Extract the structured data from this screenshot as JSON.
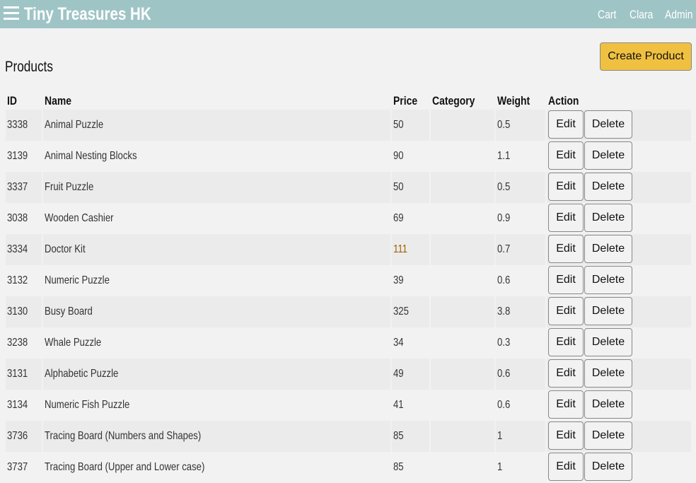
{
  "header": {
    "brand": "Tiny Treasures HK",
    "nav": [
      "Cart",
      "Clara",
      "Admin"
    ]
  },
  "page": {
    "title": "Products",
    "create_label": "Create Product"
  },
  "table": {
    "columns": [
      "ID",
      "Name",
      "Price",
      "Category",
      "Weight",
      "Action"
    ],
    "edit_label": "Edit",
    "delete_label": "Delete",
    "highlight_color": "#a06000",
    "rows": [
      {
        "id": "3338",
        "name": "Animal Puzzle",
        "price": "50",
        "category": "",
        "weight": "0.5"
      },
      {
        "id": "3139",
        "name": "Animal Nesting Blocks",
        "price": "90",
        "category": "",
        "weight": "1.1"
      },
      {
        "id": "3337",
        "name": "Fruit Puzzle",
        "price": "50",
        "category": "",
        "weight": "0.5"
      },
      {
        "id": "3038",
        "name": "Wooden Cashier",
        "price": "69",
        "category": "",
        "weight": "0.9"
      },
      {
        "id": "3334",
        "name": "Doctor Kit",
        "price": "111",
        "category": "",
        "weight": "0.7",
        "highlight": true
      },
      {
        "id": "3132",
        "name": "Numeric Puzzle",
        "price": "39",
        "category": "",
        "weight": "0.6"
      },
      {
        "id": "3130",
        "name": "Busy Board",
        "price": "325",
        "category": "",
        "weight": "3.8"
      },
      {
        "id": "3238",
        "name": "Whale Puzzle",
        "price": "34",
        "category": "",
        "weight": "0.3"
      },
      {
        "id": "3131",
        "name": "Alphabetic Puzzle",
        "price": "49",
        "category": "",
        "weight": "0.6"
      },
      {
        "id": "3134",
        "name": "Numeric Fish Puzzle",
        "price": "41",
        "category": "",
        "weight": "0.6"
      },
      {
        "id": "3736",
        "name": "Tracing Board (Numbers and Shapes)",
        "price": "85",
        "category": "",
        "weight": "1"
      },
      {
        "id": "3737",
        "name": "Tracing Board (Upper and Lower case)",
        "price": "85",
        "category": "",
        "weight": "1"
      }
    ]
  }
}
